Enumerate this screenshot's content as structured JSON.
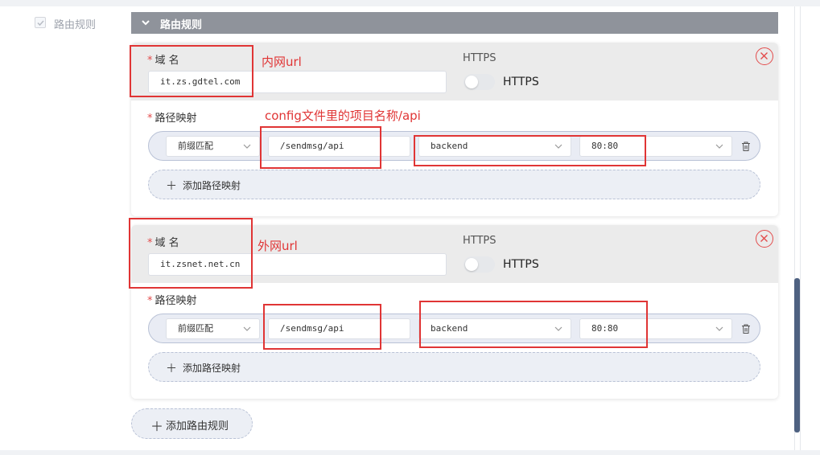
{
  "sidebar": {
    "checkbox_label": "路由规则"
  },
  "section": {
    "title": "路由规则"
  },
  "rules": [
    {
      "domain_label": "域 名",
      "domain_value": "it.zs.gdtel.com",
      "https_title": "HTTPS",
      "https_toggle_label": "HTTPS",
      "path_mapping_label": "路径映射",
      "mapping": {
        "match_type": "前缀匹配",
        "path": "/sendmsg/api",
        "service": "backend",
        "port": "80:80"
      },
      "add_path_label": "添加路径映射"
    },
    {
      "domain_label": "域 名",
      "domain_value": "it.zsnet.net.cn",
      "https_title": "HTTPS",
      "https_toggle_label": "HTTPS",
      "path_mapping_label": "路径映射",
      "mapping": {
        "match_type": "前缀匹配",
        "path": "/sendmsg/api",
        "service": "backend",
        "port": "80:80"
      },
      "add_path_label": "添加路径映射"
    }
  ],
  "add_rule_label": "添加路由规则",
  "annotations": {
    "intranet": "内网url",
    "config": "config文件里的项目名称/api",
    "extranet": "外网url"
  },
  "colors": {
    "annotation": "#e03535",
    "header": "#8f939b",
    "scroll_thumb": "#4e6181"
  }
}
